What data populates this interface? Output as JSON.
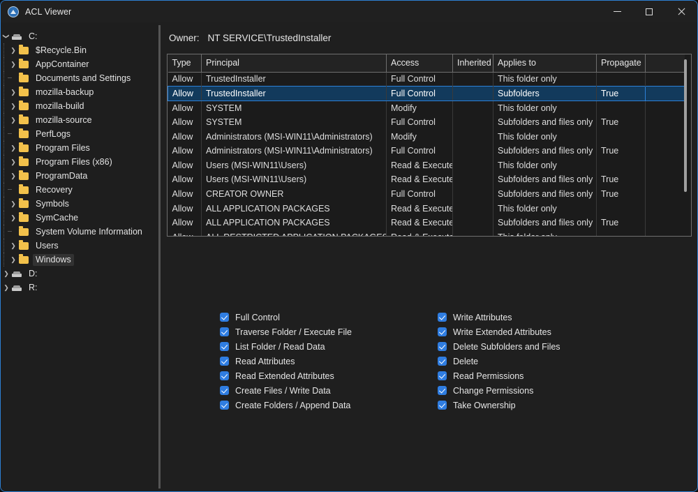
{
  "window": {
    "title": "ACL Viewer",
    "icon": "acl-viewer-icon",
    "minimize_label": "Minimize",
    "maximize_label": "Maximize",
    "close_label": "Close",
    "accent_color": "#2d7fd3",
    "background_color": "#1f1f1f"
  },
  "tree": {
    "nodes": [
      {
        "label": "C:",
        "type": "drive",
        "depth": 0,
        "expander": "open",
        "selected": false
      },
      {
        "label": "$Recycle.Bin",
        "type": "folder",
        "depth": 1,
        "expander": "closed",
        "selected": false
      },
      {
        "label": "AppContainer",
        "type": "folder",
        "depth": 1,
        "expander": "closed",
        "selected": false
      },
      {
        "label": "Documents and Settings",
        "type": "folder",
        "depth": 1,
        "expander": "leaf",
        "selected": false
      },
      {
        "label": "mozilla-backup",
        "type": "folder",
        "depth": 1,
        "expander": "closed",
        "selected": false
      },
      {
        "label": "mozilla-build",
        "type": "folder",
        "depth": 1,
        "expander": "closed",
        "selected": false
      },
      {
        "label": "mozilla-source",
        "type": "folder",
        "depth": 1,
        "expander": "closed",
        "selected": false
      },
      {
        "label": "PerfLogs",
        "type": "folder",
        "depth": 1,
        "expander": "leaf",
        "selected": false
      },
      {
        "label": "Program Files",
        "type": "folder",
        "depth": 1,
        "expander": "closed",
        "selected": false
      },
      {
        "label": "Program Files (x86)",
        "type": "folder",
        "depth": 1,
        "expander": "closed",
        "selected": false
      },
      {
        "label": "ProgramData",
        "type": "folder",
        "depth": 1,
        "expander": "closed",
        "selected": false
      },
      {
        "label": "Recovery",
        "type": "folder",
        "depth": 1,
        "expander": "leaf",
        "selected": false
      },
      {
        "label": "Symbols",
        "type": "folder",
        "depth": 1,
        "expander": "closed",
        "selected": false
      },
      {
        "label": "SymCache",
        "type": "folder",
        "depth": 1,
        "expander": "closed",
        "selected": false
      },
      {
        "label": "System Volume Information",
        "type": "folder",
        "depth": 1,
        "expander": "leaf",
        "selected": false
      },
      {
        "label": "Users",
        "type": "folder",
        "depth": 1,
        "expander": "closed",
        "selected": false
      },
      {
        "label": "Windows",
        "type": "folder",
        "depth": 1,
        "expander": "closed",
        "selected": true
      },
      {
        "label": "D:",
        "type": "drive",
        "depth": 0,
        "expander": "closed",
        "selected": false
      },
      {
        "label": "R:",
        "type": "drive",
        "depth": 0,
        "expander": "closed",
        "selected": false
      }
    ]
  },
  "owner": {
    "label": "Owner:",
    "value": "NT SERVICE\\TrustedInstaller"
  },
  "acl_table": {
    "columns": [
      "Type",
      "Principal",
      "Access",
      "Inherited",
      "Applies to",
      "Propagate"
    ],
    "selected_row_index": 1,
    "rows": [
      {
        "type": "Allow",
        "principal": "TrustedInstaller",
        "access": "Full Control",
        "inherited": "",
        "applies_to": "This folder only",
        "propagate": ""
      },
      {
        "type": "Allow",
        "principal": "TrustedInstaller",
        "access": "Full Control",
        "inherited": "",
        "applies_to": "Subfolders",
        "propagate": "True"
      },
      {
        "type": "Allow",
        "principal": "SYSTEM",
        "access": "Modify",
        "inherited": "",
        "applies_to": "This folder only",
        "propagate": ""
      },
      {
        "type": "Allow",
        "principal": "SYSTEM",
        "access": "Full Control",
        "inherited": "",
        "applies_to": "Subfolders and files only",
        "propagate": "True"
      },
      {
        "type": "Allow",
        "principal": "Administrators (MSI-WIN11\\Administrators)",
        "access": "Modify",
        "inherited": "",
        "applies_to": "This folder only",
        "propagate": ""
      },
      {
        "type": "Allow",
        "principal": "Administrators (MSI-WIN11\\Administrators)",
        "access": "Full Control",
        "inherited": "",
        "applies_to": "Subfolders and files only",
        "propagate": "True"
      },
      {
        "type": "Allow",
        "principal": "Users (MSI-WIN11\\Users)",
        "access": "Read & Execute",
        "inherited": "",
        "applies_to": "This folder only",
        "propagate": ""
      },
      {
        "type": "Allow",
        "principal": "Users (MSI-WIN11\\Users)",
        "access": "Read & Execute",
        "inherited": "",
        "applies_to": "Subfolders and files only",
        "propagate": "True"
      },
      {
        "type": "Allow",
        "principal": "CREATOR OWNER",
        "access": "Full Control",
        "inherited": "",
        "applies_to": "Subfolders and files only",
        "propagate": "True"
      },
      {
        "type": "Allow",
        "principal": "ALL APPLICATION PACKAGES",
        "access": "Read & Execute",
        "inherited": "",
        "applies_to": "This folder only",
        "propagate": ""
      },
      {
        "type": "Allow",
        "principal": "ALL APPLICATION PACKAGES",
        "access": "Read & Execute",
        "inherited": "",
        "applies_to": "Subfolders and files only",
        "propagate": "True"
      },
      {
        "type": "Allow",
        "principal": "ALL RESTRICTED APPLICATION PACKAGES",
        "access": "Read & Execute",
        "inherited": "",
        "applies_to": "This folder only",
        "propagate": ""
      }
    ]
  },
  "permissions": {
    "left_column": [
      {
        "label": "Full Control",
        "checked": true
      },
      {
        "label": "Traverse Folder / Execute File",
        "checked": true
      },
      {
        "label": "List Folder / Read Data",
        "checked": true
      },
      {
        "label": "Read Attributes",
        "checked": true
      },
      {
        "label": "Read Extended Attributes",
        "checked": true
      },
      {
        "label": "Create Files / Write Data",
        "checked": true
      },
      {
        "label": "Create Folders / Append Data",
        "checked": true
      }
    ],
    "right_column": [
      {
        "label": "Write Attributes",
        "checked": true
      },
      {
        "label": "Write Extended Attributes",
        "checked": true
      },
      {
        "label": "Delete Subfolders and Files",
        "checked": true
      },
      {
        "label": "Delete",
        "checked": true
      },
      {
        "label": "Read Permissions",
        "checked": true
      },
      {
        "label": "Change Permissions",
        "checked": true
      },
      {
        "label": "Take Ownership",
        "checked": true
      }
    ]
  }
}
